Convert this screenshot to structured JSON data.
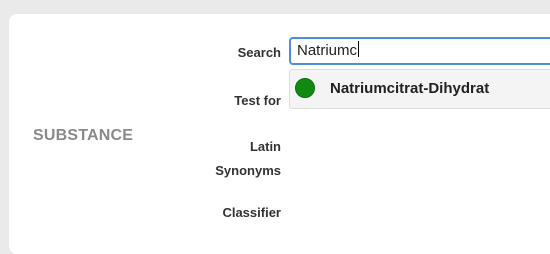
{
  "section": {
    "title": "SUBSTANCE"
  },
  "fields": {
    "search_label": "Search",
    "test_for_label": "Test for",
    "latin_label": "Latin",
    "synonyms_label": "Synonyms",
    "classifier_label": "Classifier"
  },
  "search": {
    "value": "Natriumc"
  },
  "suggestions": [
    {
      "label": "Natriumcitrat-Dihydrat",
      "status_color": "#128a12",
      "icon": "green-circle-icon"
    }
  ]
}
